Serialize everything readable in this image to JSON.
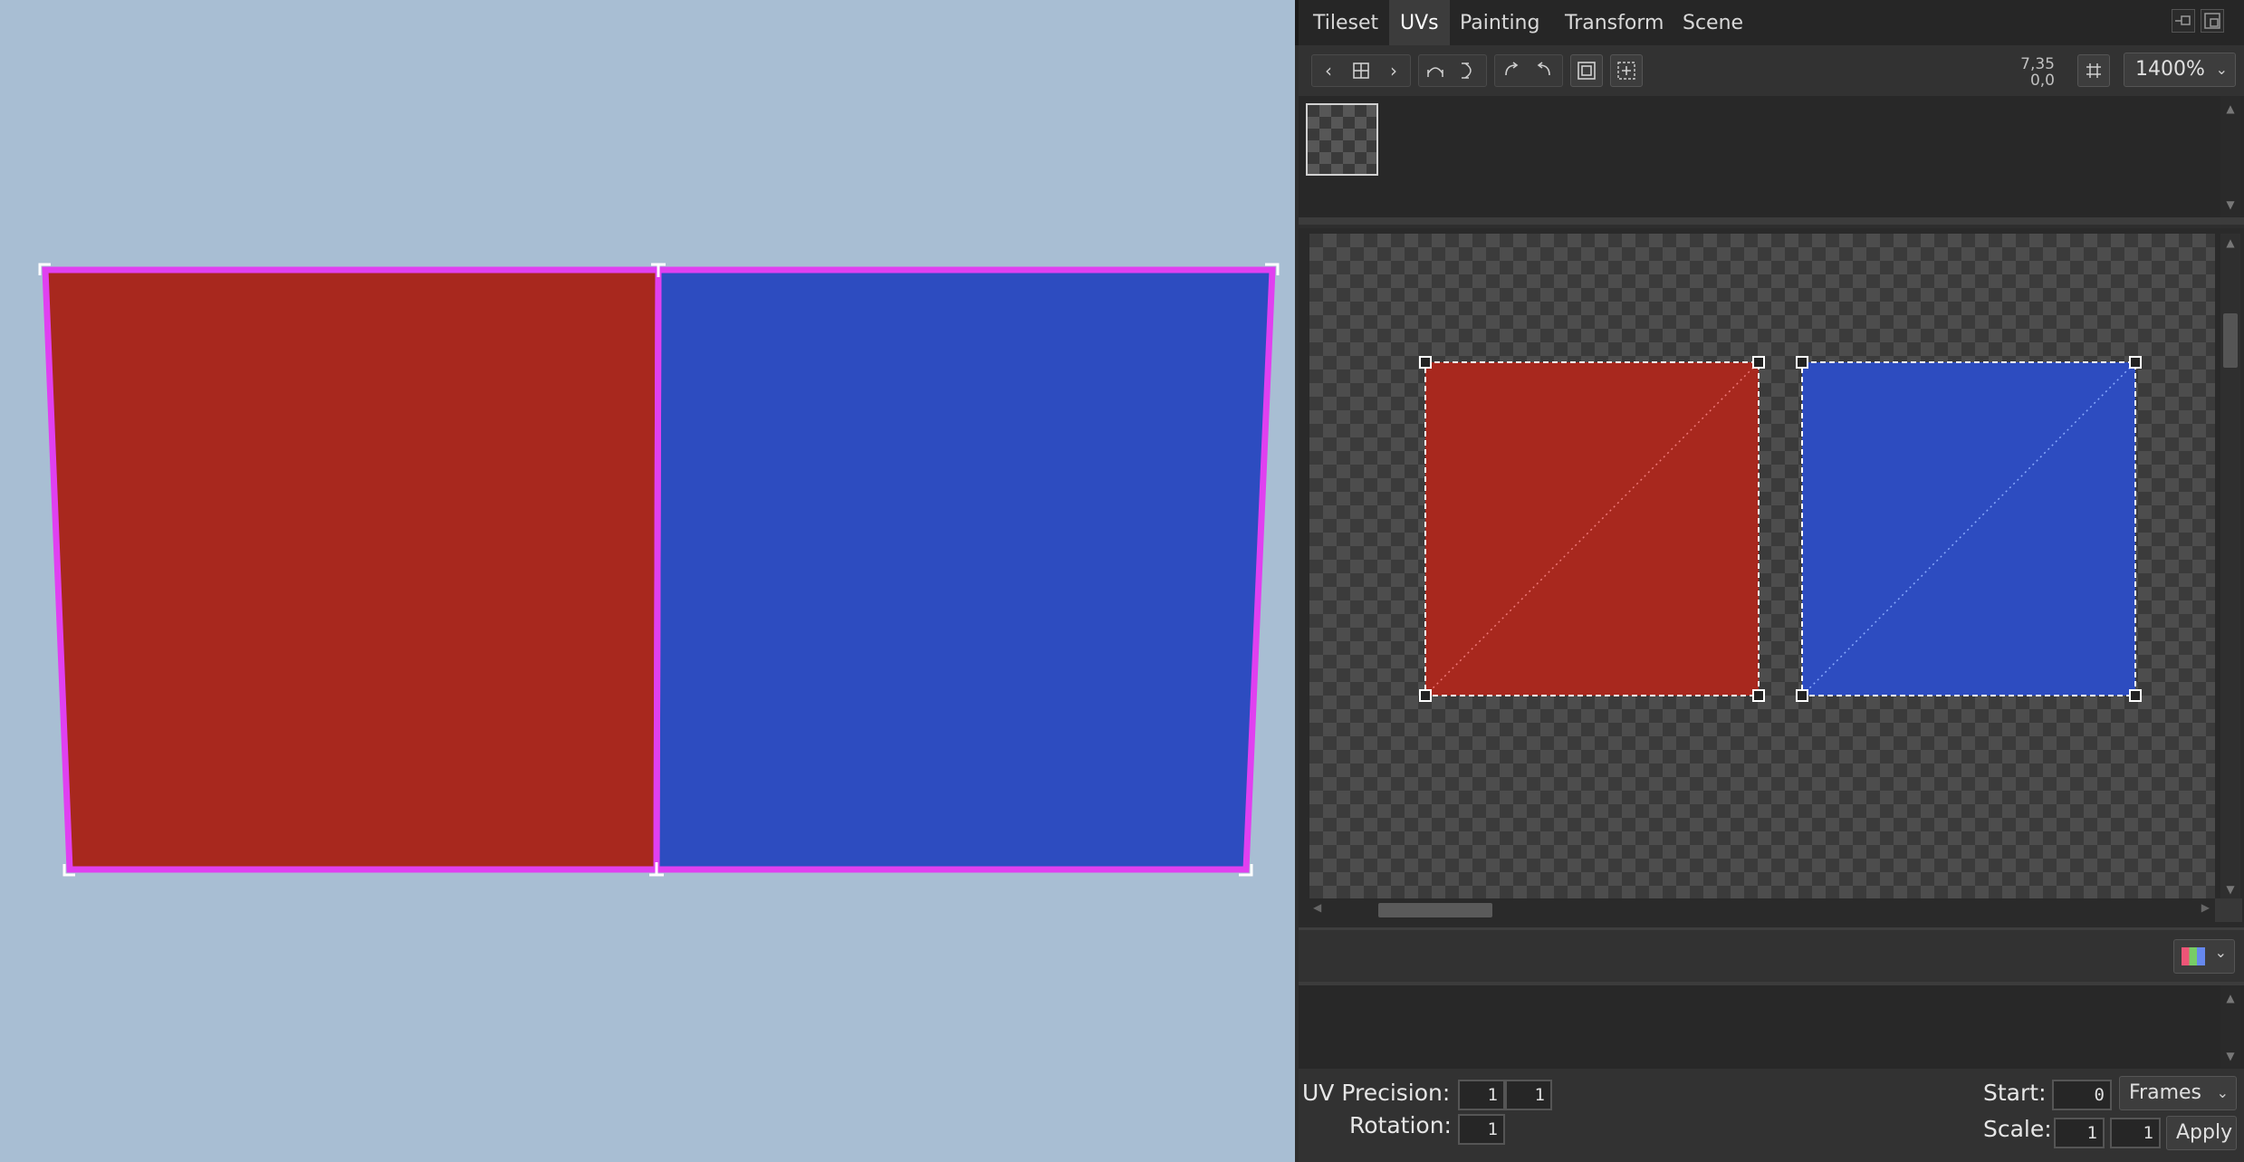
{
  "tabs": [
    "Tileset",
    "UVs",
    "Painting",
    "Transform",
    "Scene"
  ],
  "active_tab": "UVs",
  "toolbar": {
    "coords_line1": "7,35",
    "coords_line2": "0,0",
    "zoom": "1400%"
  },
  "viewport": {
    "faces": [
      {
        "name": "red-face",
        "color": "#a8281e"
      },
      {
        "name": "blue-face",
        "color": "#2d4cc0"
      }
    ],
    "outline_color": "#e040f0",
    "background": "#a8bed3"
  },
  "bottom": {
    "uv_precision_label": "UV Precision:",
    "uv_precision_x": "1",
    "uv_precision_y": "1",
    "rotation_label": "Rotation:",
    "rotation_value": "1",
    "start_label": "Start:",
    "start_value": "0",
    "frames_option": "Frames",
    "scale_label": "Scale:",
    "scale_x": "1",
    "scale_y": "1",
    "apply_label": "Apply"
  }
}
